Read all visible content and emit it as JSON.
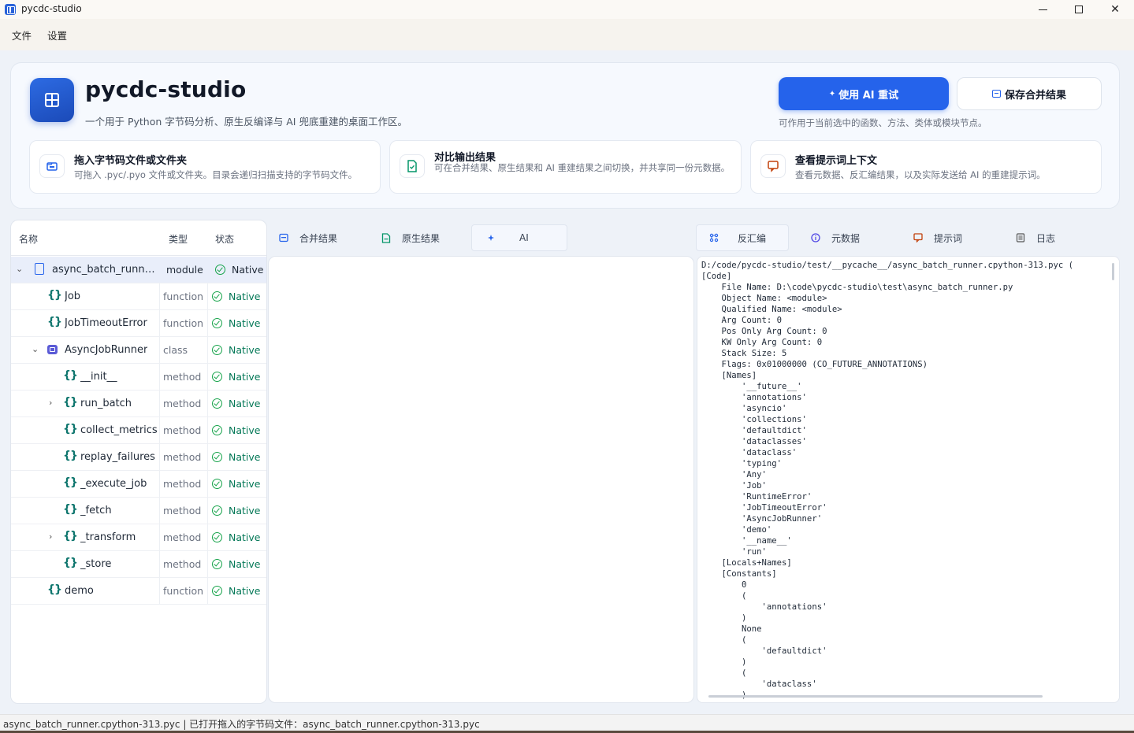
{
  "window": {
    "title": "pycdc-studio"
  },
  "menu": [
    "文件",
    "设置"
  ],
  "header": {
    "app_name": "pycdc-studio",
    "description": "一个用于 Python 字节码分析、原生反编译与 AI 兜底重建的桌面工作区。",
    "ai_button": "使用 AI 重试",
    "save_button": "保存合并结果",
    "ai_hint": "可作用于当前选中的函数、方法、类体或模块节点。",
    "features": [
      {
        "title": "拖入字节码文件或文件夹",
        "desc": "可拖入 .pyc/.pyo 文件或文件夹。目录会递归扫描支持的字节码文件。",
        "icon": "folder-icon"
      },
      {
        "title": "对比输出结果",
        "desc": "可在合并结果、原生结果和 AI 重建结果之间切换，并共享同一份元数据。",
        "icon": "document-icon"
      },
      {
        "title": "查看提示词上下文",
        "desc": "查看元数据、反汇编结果，以及实际发送给 AI 的重建提示词。",
        "icon": "chat-icon"
      }
    ]
  },
  "tree": {
    "columns": {
      "name": "名称",
      "type": "类型",
      "status": "状态"
    },
    "rows": [
      {
        "name": "async_batch_runner.c...",
        "type": "module",
        "status": "Native"
      },
      {
        "name": "Job",
        "type": "function",
        "status": "Native"
      },
      {
        "name": "JobTimeoutError",
        "type": "function",
        "status": "Native"
      },
      {
        "name": "AsyncJobRunner",
        "type": "class",
        "status": "Native"
      },
      {
        "name": "__init__",
        "type": "method",
        "status": "Native"
      },
      {
        "name": "run_batch",
        "type": "method",
        "status": "Native"
      },
      {
        "name": "collect_metrics",
        "type": "method",
        "status": "Native"
      },
      {
        "name": "replay_failures",
        "type": "method",
        "status": "Native"
      },
      {
        "name": "_execute_job",
        "type": "method",
        "status": "Native"
      },
      {
        "name": "_fetch",
        "type": "method",
        "status": "Native"
      },
      {
        "name": "_transform",
        "type": "method",
        "status": "Native"
      },
      {
        "name": "_store",
        "type": "method",
        "status": "Native"
      },
      {
        "name": "demo",
        "type": "function",
        "status": "Native"
      }
    ]
  },
  "middle_tabs": {
    "merged": "合并结果",
    "native": "原生结果",
    "ai": "AI"
  },
  "right_tabs": {
    "disasm": "反汇编",
    "metadata": "元数据",
    "prompt": "提示词",
    "log": "日志"
  },
  "disassembly": "D:/code/pycdc-studio/test/__pycache__/async_batch_runner.cpython-313.pyc (\n[Code]\n    File Name: D:\\code\\pycdc-studio\\test\\async_batch_runner.py\n    Object Name: <module>\n    Qualified Name: <module>\n    Arg Count: 0\n    Pos Only Arg Count: 0\n    KW Only Arg Count: 0\n    Stack Size: 5\n    Flags: 0x01000000 (CO_FUTURE_ANNOTATIONS)\n    [Names]\n        '__future__'\n        'annotations'\n        'asyncio'\n        'collections'\n        'defaultdict'\n        'dataclasses'\n        'dataclass'\n        'typing'\n        'Any'\n        'Job'\n        'RuntimeError'\n        'JobTimeoutError'\n        'AsyncJobRunner'\n        'demo'\n        '__name__'\n        'run'\n    [Locals+Names]\n    [Constants]\n        0\n        (\n            'annotations'\n        )\n        None\n        (\n            'defaultdict'\n        )\n        (\n            'dataclass'\n        )",
  "status_bar": "async_batch_runner.cpython-313.pyc | 已打开拖入的字节码文件：async_batch_runner.cpython-313.pyc"
}
